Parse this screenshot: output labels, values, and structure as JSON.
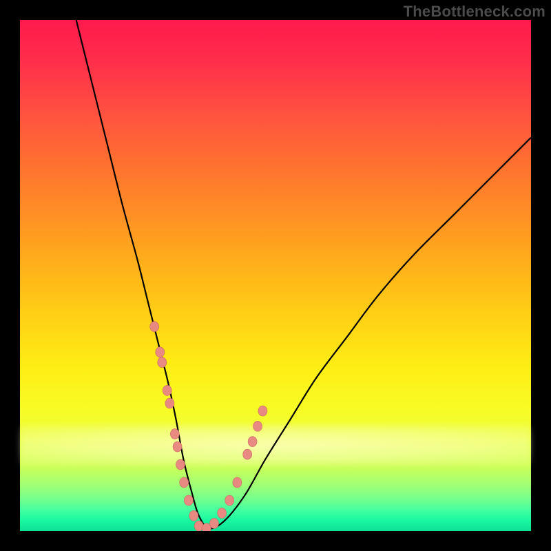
{
  "watermark": "TheBottleneck.com",
  "colors": {
    "frame": "#000000",
    "curve": "#000000",
    "marker_fill": "#e88a82",
    "marker_stroke": "#c86a60"
  },
  "chart_data": {
    "type": "line",
    "title": "",
    "xlabel": "",
    "ylabel": "",
    "xlim": [
      0,
      100
    ],
    "ylim": [
      0,
      100
    ],
    "grid": false,
    "legend": false,
    "series": [
      {
        "name": "bottleneck-curve",
        "x": [
          11,
          14,
          17,
          20,
          23,
          25,
          27,
          29,
          30.5,
          32,
          33.5,
          35,
          37,
          40,
          44,
          48,
          53,
          58,
          64,
          70,
          77,
          85,
          93,
          100
        ],
        "y": [
          100,
          88,
          76,
          64,
          53,
          45,
          37,
          29,
          22,
          14,
          8,
          3,
          0.5,
          2,
          7,
          14,
          22,
          30,
          38,
          46,
          54,
          62,
          70,
          77
        ]
      }
    ],
    "markers": {
      "name": "highlight-points",
      "x_left": [
        26.3,
        27.4,
        27.8,
        28.8,
        29.3,
        30.3,
        30.8,
        31.4,
        32.1,
        33.0,
        34.0,
        35.0
      ],
      "y_left": [
        40.0,
        35.0,
        33.0,
        27.5,
        25.0,
        19.0,
        16.5,
        13.0,
        9.5,
        6.0,
        3.0,
        1.0
      ],
      "x_right": [
        36.5,
        38.0,
        39.5,
        41.0,
        42.5,
        44.5,
        45.5,
        46.5,
        47.5
      ],
      "y_right": [
        0.5,
        1.5,
        3.5,
        6.0,
        9.5,
        15.0,
        17.5,
        20.5,
        23.5
      ]
    }
  }
}
